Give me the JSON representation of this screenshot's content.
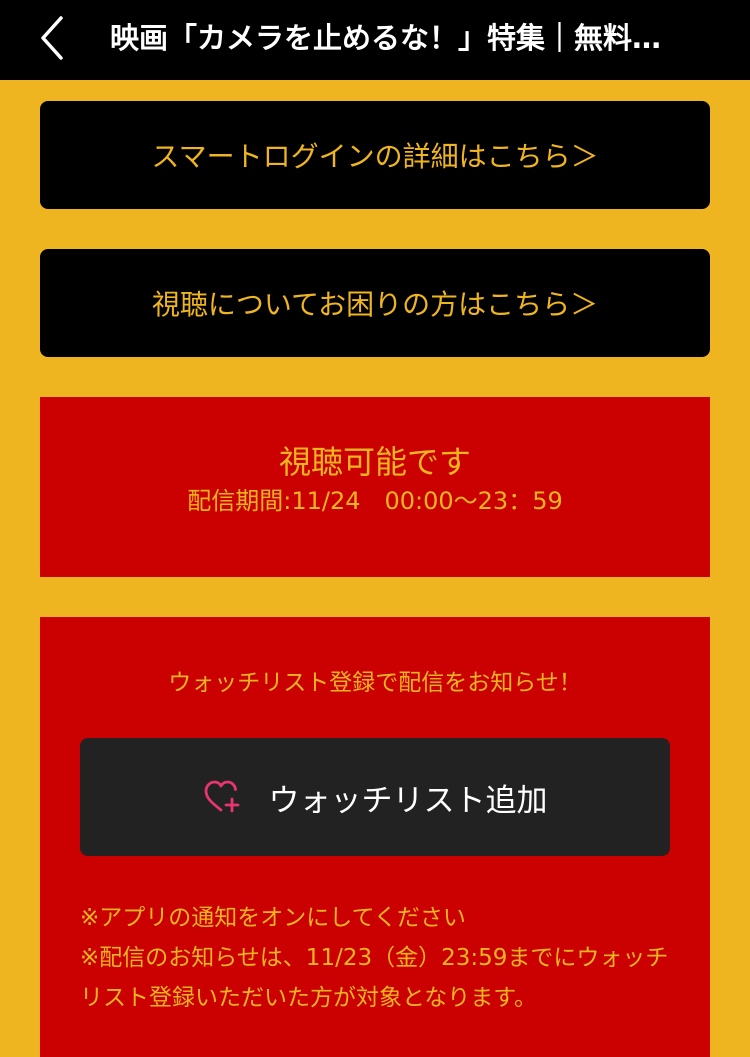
{
  "header": {
    "title": "映画「カメラを止めるな！」特集｜無料…",
    "back_icon": "chevron-left-icon"
  },
  "buttons": {
    "smart_login": "スマートログインの詳細はこちら＞",
    "viewing_help": "視聴についてお困りの方はこちら＞"
  },
  "status": {
    "title": "視聴可能です",
    "period": "配信期間:11/24　00:00～23：59"
  },
  "watchlist": {
    "lead": "ウォッチリスト登録で配信をお知らせ！",
    "button_label": "ウォッチリスト追加",
    "button_icon": "heart-plus-icon",
    "notes": [
      "※アプリの通知をオンにしてください",
      "※配信のお知らせは、11/23（金）23:59までにウォッチリスト登録いただいた方が対象となります。"
    ]
  },
  "colors": {
    "background": "#EFB520",
    "header": "#000000",
    "panel_red": "#CB0000",
    "accent_text": "#EFB520",
    "watch_button": "#222222",
    "heart": "#E8356F"
  }
}
